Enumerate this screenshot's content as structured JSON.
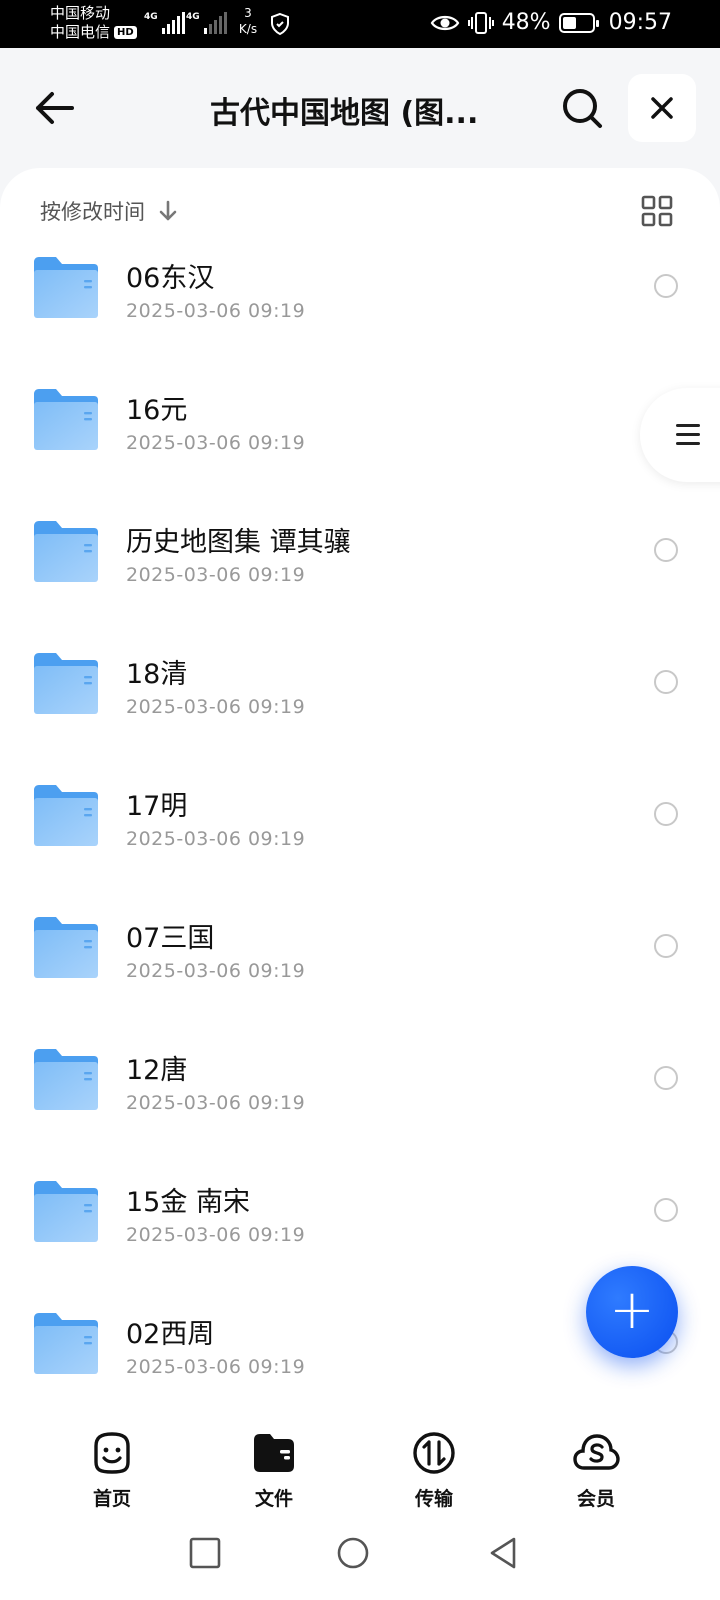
{
  "status_bar": {
    "carrier1": "中国移动",
    "carrier2": "中国电信",
    "hd_badge": "HD",
    "net1": "4G",
    "net2": "4G",
    "speed_value": "3",
    "speed_unit": "K/s",
    "battery": "48%",
    "battery_level": 0.48,
    "time": "09:57"
  },
  "header": {
    "title": "古代中国地图 (图..."
  },
  "toolbar": {
    "sort_label": "按修改时间"
  },
  "files": [
    {
      "name": "06东汉",
      "date": "2025-03-06 09:19"
    },
    {
      "name": "16元",
      "date": "2025-03-06 09:19"
    },
    {
      "name": "历史地图集 谭其骧",
      "date": "2025-03-06 09:19"
    },
    {
      "name": "18清",
      "date": "2025-03-06 09:19"
    },
    {
      "name": "17明",
      "date": "2025-03-06 09:19"
    },
    {
      "name": "07三国",
      "date": "2025-03-06 09:19"
    },
    {
      "name": "12唐",
      "date": "2025-03-06 09:19"
    },
    {
      "name": "15金 南宋",
      "date": "2025-03-06 09:19"
    },
    {
      "name": "02西周",
      "date": "2025-03-06 09:19"
    }
  ],
  "bottom_nav": {
    "home": "首页",
    "files": "文件",
    "transfer": "传输",
    "vip": "会员"
  },
  "colors": {
    "accent": "#1a5cff",
    "folder": "#6cb2f5"
  }
}
